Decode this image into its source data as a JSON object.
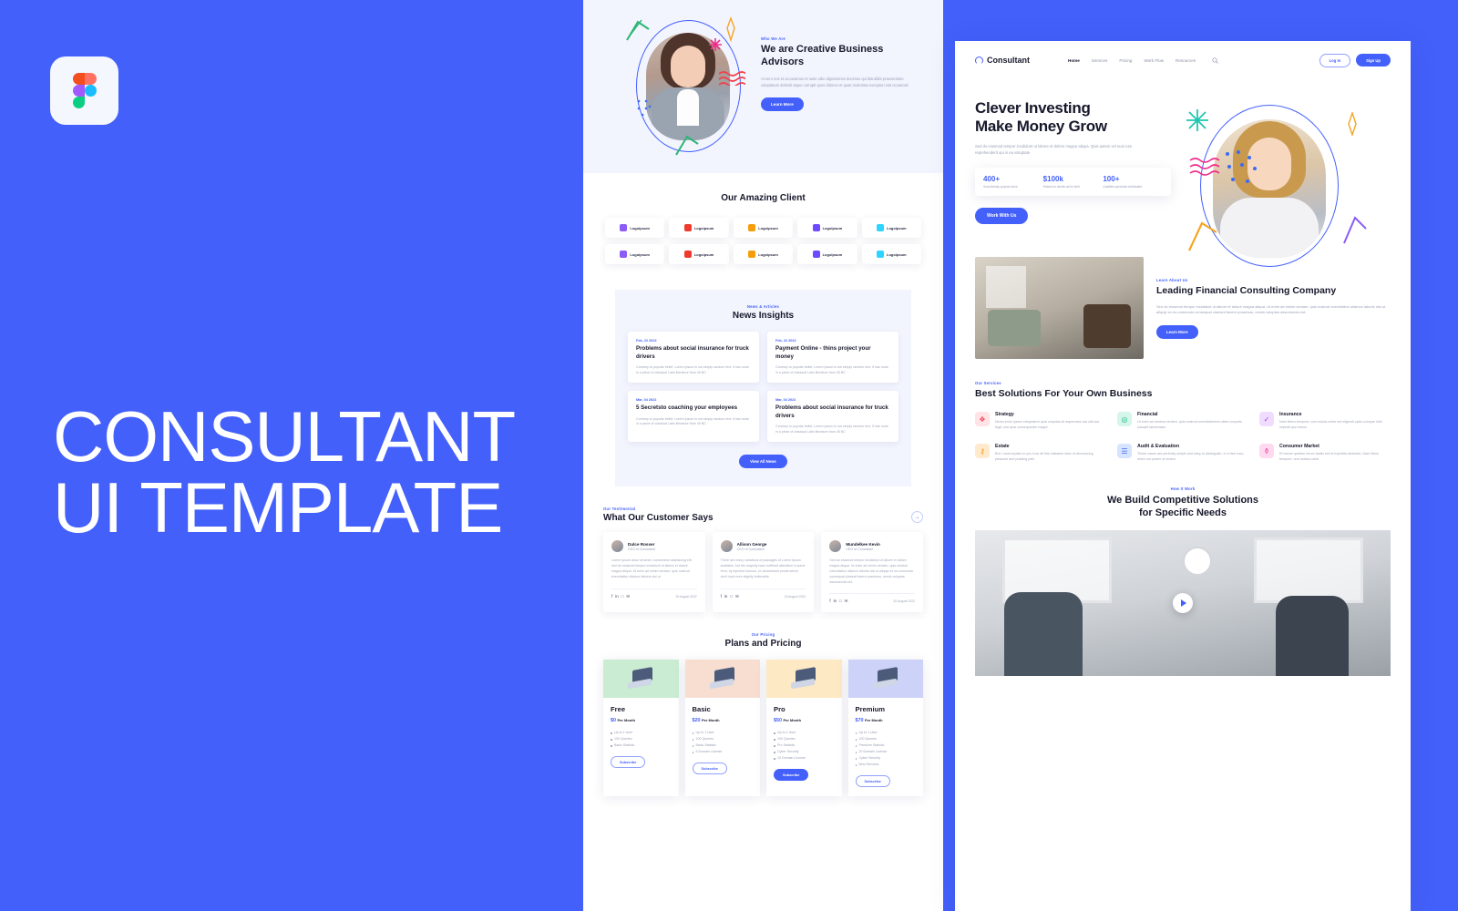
{
  "cover": {
    "title_line1": "CONSULTANT",
    "title_line2": "UI TEMPLATE",
    "background": "#4360fb",
    "logo": "figma-logo"
  },
  "mock_a": {
    "hero": {
      "eyebrow": "Who We Are",
      "title": "We are Creative Business Advisors",
      "body": "At vero eos et accusamus et iusto odio dignissimos ducimus qui blanditiis praesentium voluptatum deleniti atque corrupti quos dolores et quas molestias excepturi sint occaecati",
      "button": "Learn More"
    },
    "clients": {
      "title": "Our Amazing Client",
      "logos": [
        {
          "label": "Logoipsum",
          "color": "#8b5cf6"
        },
        {
          "label": "Logoipsum",
          "color": "#ef3b2d"
        },
        {
          "label": "Logoipsum",
          "color": "#f59e0b"
        },
        {
          "label": "Logoipsum",
          "color": "#6d4aff"
        },
        {
          "label": "Logoipsum",
          "color": "#2dd4ff"
        },
        {
          "label": "Logoipsum",
          "color": "#8b5cf6"
        },
        {
          "label": "Logoipsum",
          "color": "#ef3b2d"
        },
        {
          "label": "Logoipsum",
          "color": "#f59e0b"
        },
        {
          "label": "Logoipsum",
          "color": "#6d4aff"
        },
        {
          "label": "Logoipsum",
          "color": "#2dd4ff"
        }
      ]
    },
    "news": {
      "eyebrow": "News & Articles",
      "title": "News Insights",
      "button": "View All News",
      "cards": [
        {
          "date": "Feb, 22 2022",
          "title": "Problems about social insurance for truck drivers",
          "body": "Contrary to popular belief, Lorem Ipsum is not simply random text. It has roots in a piece of classical Latin literature from 45 BC"
        },
        {
          "date": "Feb, 22 2022",
          "title": "Payment Online - thins project your money",
          "body": "Contrary to popular belief, Lorem Ipsum is not simply random text. It has roots in a piece of classical Latin literature from 45 BC"
        },
        {
          "date": "Mar, 04 2022",
          "title": "5 Secretsto coaching your employees",
          "body": "Contrary to popular belief, Lorem Ipsum is not simply random text. It has roots in a piece of classical Latin literature from 45 BC"
        },
        {
          "date": "Mar, 04 2022",
          "title": "Problems about social insurance for truck drivers",
          "body": "Contrary to popular belief, Lorem Ipsum is not simply random text. It has roots in a piece of classical Latin literature from 45 BC"
        }
      ]
    },
    "testimonials": {
      "eyebrow": "Our Testimonial",
      "title": "What Our Customer Says",
      "next_arrow": "→",
      "cards": [
        {
          "name": "Dulce Rosser",
          "role": "CEO of Consultant",
          "body": "Lorem Ipsum dolor sit amet, consectetur adipisicing elit, sed do eiusmod tempor incididunt ut labore et dolore magna aliqua. Ut enim ad minim veniam, quis nostrud exercitation ullamco laboris nisi ut",
          "date": "15 August 2022"
        },
        {
          "name": "Allison George",
          "role": "CEO of Consultant",
          "body": "There are many variations of passages of Lorem Ipsum available, but the majority have suffered alteration in some form, by injected humour, or randomised words which don't look even slightly believable",
          "date": "18 August 2022"
        },
        {
          "name": "Mundelkee Kevin",
          "role": "CEO of Consultant",
          "body": "Sed do eiusmod tempor incididunt ut labore et dolore magna aliqua. Ut enim ad minim veniam, quis nostrud exercitation ullamco laboris nisi ut aliquip ex ea commodo consequat planeat facere possimus, omnis voluptas assumenda est.",
          "date": "20 August 2022"
        }
      ]
    },
    "pricing": {
      "eyebrow": "Our Pricing",
      "title": "Plans and Pricing",
      "per_month": "Per Month",
      "plans": [
        {
          "name": "Free",
          "price": "$0",
          "bg": "#c9ecd2",
          "btn": "Subscribe",
          "highlight": false,
          "features": [
            "Up to 1 User",
            "100 Queries",
            "Basic Statistic"
          ]
        },
        {
          "name": "Basic",
          "price": "$20",
          "bg": "#f7ded1",
          "btn": "Subscribe",
          "highlight": false,
          "features": [
            "Up to 1 User",
            "100 Queries",
            "Basic Statistic",
            "5 Domain License"
          ]
        },
        {
          "name": "Pro",
          "price": "$50",
          "bg": "#fde9c4",
          "btn": "Subscribe",
          "highlight": true,
          "features": [
            "Up to 1 User",
            "100 Queries",
            "Pro Statistic",
            "Cyber Security",
            "10 Domain License"
          ]
        },
        {
          "name": "Premium",
          "price": "$70",
          "bg": "#ccd2f8",
          "btn": "Subscribe",
          "highlight": false,
          "features": [
            "Up to 1 User",
            "100 Queries",
            "Premium Statistic",
            "20 Domain License",
            "Cyber Security",
            "Best Services"
          ]
        }
      ]
    }
  },
  "mock_b": {
    "nav": {
      "brand": "Consultant",
      "links": [
        "Home",
        "Services",
        "Pricing",
        "Work Flow",
        "Resources"
      ],
      "search_icon": "search-icon",
      "login": "Log In",
      "signup": "Sign Up"
    },
    "hero": {
      "title_line1": "Clever Investing",
      "title_line2": "Make Money Grow",
      "body": "Sed do eiusmod tempor incididunt ut labore et dolore magna aliqua. Quis autem vel eum iure reprehenderit qui in ea voluptate",
      "button": "Work With Us",
      "stats": [
        {
          "num": "400+",
          "caption": "Successfully projects done"
        },
        {
          "num": "$100k",
          "caption": "Raised on clients we've built"
        },
        {
          "num": "100+",
          "caption": "Qualified specialist certificated"
        }
      ]
    },
    "about": {
      "eyebrow": "Learn About Us",
      "title": "Leading Financial Consulting Company",
      "body": "Sed do eiusmod tempor incididunt ut labore et dolore magna aliqua. Ut enim ad minim veniam, quis nostrud exercitation ullamco laboris nisi ut aliquip ex ea commodo consequat clamant facere possimus, omnis voluptas assumenda est.",
      "button": "Learn More"
    },
    "services": {
      "eyebrow": "Our Services",
      "title": "Best Solutions For Your  Own Business",
      "items": [
        {
          "name": "Strategy",
          "icon": "puzzle-icon",
          "glyph": "❖",
          "bg": "#ffe3e6",
          "color": "#f04a57",
          "desc": "Nemo enim ipsam voluptatem quia voluptas sit aspernatur aut odit aut fugit, sed quia consequuntur magni"
        },
        {
          "name": "Financial",
          "icon": "coin-icon",
          "glyph": "◎",
          "bg": "#d6f6ea",
          "color": "#17b890",
          "desc": "Ut enim ad minima veniam, quis nostrud exercitationem ullam corporis suscipit laboriosam"
        },
        {
          "name": "Insurance",
          "icon": "shield-doc-icon",
          "glyph": "✓",
          "bg": "#f0dcff",
          "color": "#9d3bf5",
          "desc": "Nam libero tempore, cum soluta nobis est eligendi optio cumque nihil impedit quo minus"
        },
        {
          "name": "Estate",
          "icon": "key-icon",
          "glyph": "⚷",
          "bg": "#ffeacd",
          "color": "#f59e0b",
          "desc": "But I must explain to you how all this mistaken idea of denouncing pleasure and praising pain"
        },
        {
          "name": "Audit & Evaluation",
          "icon": "chart-doc-icon",
          "glyph": "☰",
          "bg": "#d7e4ff",
          "color": "#3b6bf5",
          "desc": "These cases are perfectly simple and easy to distinguish. In a free hour, when our power of choice"
        },
        {
          "name": "Consumer Market",
          "icon": "cart-icon",
          "glyph": "⚱",
          "bg": "#ffd9ef",
          "color": "#f0399b",
          "desc": "Et harum quidem rerum facilis est et expedita distinctio. Nam libero tempore, cum soluta nobis"
        }
      ]
    },
    "how": {
      "eyebrow": "How It Work",
      "title_line1": "We Build Competitive Solutions",
      "title_line2": "for Specific Needs",
      "play_icon": "play-icon"
    }
  }
}
